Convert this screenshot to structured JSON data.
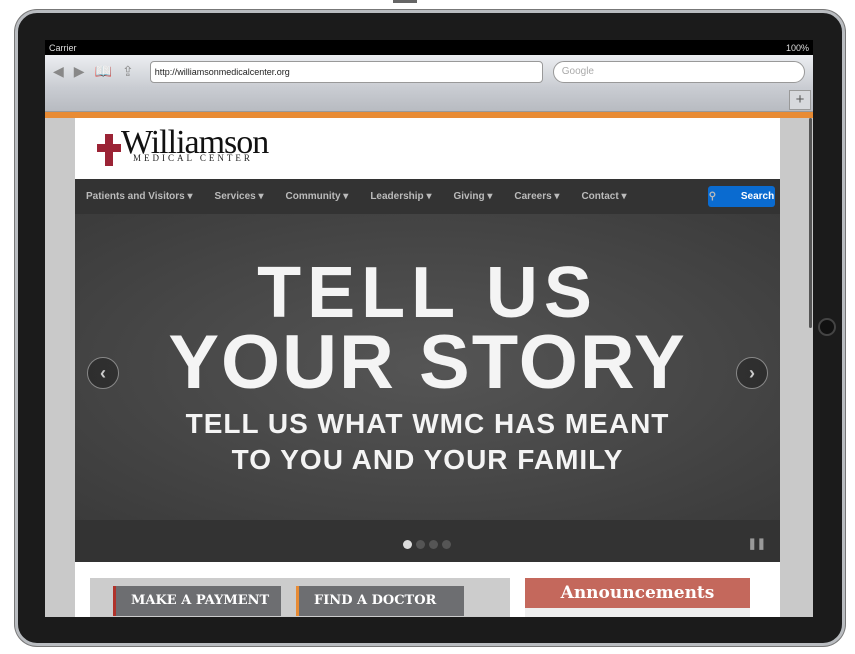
{
  "status": {
    "carrier": "Carrier",
    "battery": "100%"
  },
  "browser": {
    "url": "http://williamsonmedicalcenter.org",
    "search_placeholder": "Google",
    "new_tab": "+"
  },
  "logo": {
    "name": "Williamson",
    "sub": "MEDICAL CENTER"
  },
  "nav": {
    "items": [
      "Patients and Visitors ▾",
      "Services ▾",
      "Community ▾",
      "Leadership ▾",
      "Giving ▾",
      "Careers ▾",
      "Contact ▾"
    ],
    "search": "Search"
  },
  "banner": {
    "line1": "TELL US",
    "line2": "YOUR STORY",
    "line3": "TELL US WHAT WMC HAS MEANT",
    "line4": "TO YOU AND YOUR FAMILY",
    "slide_count": 4,
    "active_slide": 1
  },
  "quick": {
    "payment": "MAKE A PAYMENT",
    "doctor": "FIND A DOCTOR"
  },
  "announcements": {
    "title": "Announcements"
  },
  "colors": {
    "orange": "#e88b34",
    "nav": "#333333",
    "search": "#0a6bd0",
    "announce": "#c4685c",
    "logo_red": "#9b2335"
  }
}
